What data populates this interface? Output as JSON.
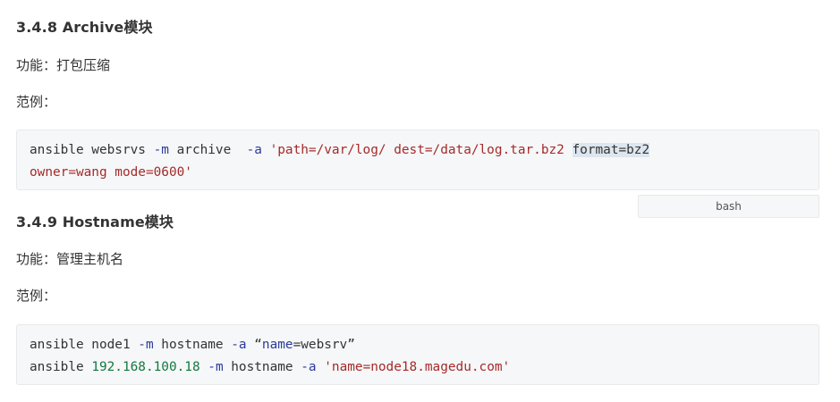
{
  "section1": {
    "title": "3.4.8 Archive模块",
    "function_text": "功能：打包压缩",
    "example_label": "范例：",
    "code": {
      "l1_cmd": "ansible websrvs ",
      "l1_opt1": "-m",
      "l1_mid": " archive  ",
      "l1_opt2": "-a",
      "l1_sp": " ",
      "l1_str": "'path=/var/log/ dest=/data/log.tar.bz2 ",
      "l1_sel": "format=bz2",
      "l2_str": "owner=wang mode=0600'"
    },
    "language": "bash"
  },
  "section2": {
    "title": "3.4.9 Hostname模块",
    "function_text": "功能：管理主机名",
    "example_label": "范例：",
    "code": {
      "l1_a": "ansible node1 ",
      "l1_opt1": "-m",
      "l1_b": " hostname ",
      "l1_opt2": "-a",
      "l1_c": " “",
      "l1_key": "name",
      "l1_d": "=websrv”",
      "l2_a": "ansible ",
      "l2_ip": "192.168.100.18",
      "l2_sp": " ",
      "l2_opt1": "-m",
      "l2_b": " hostname ",
      "l2_opt2": "-a",
      "l2_sp2": " ",
      "l2_str": "'name=node18.magedu.com'"
    }
  }
}
